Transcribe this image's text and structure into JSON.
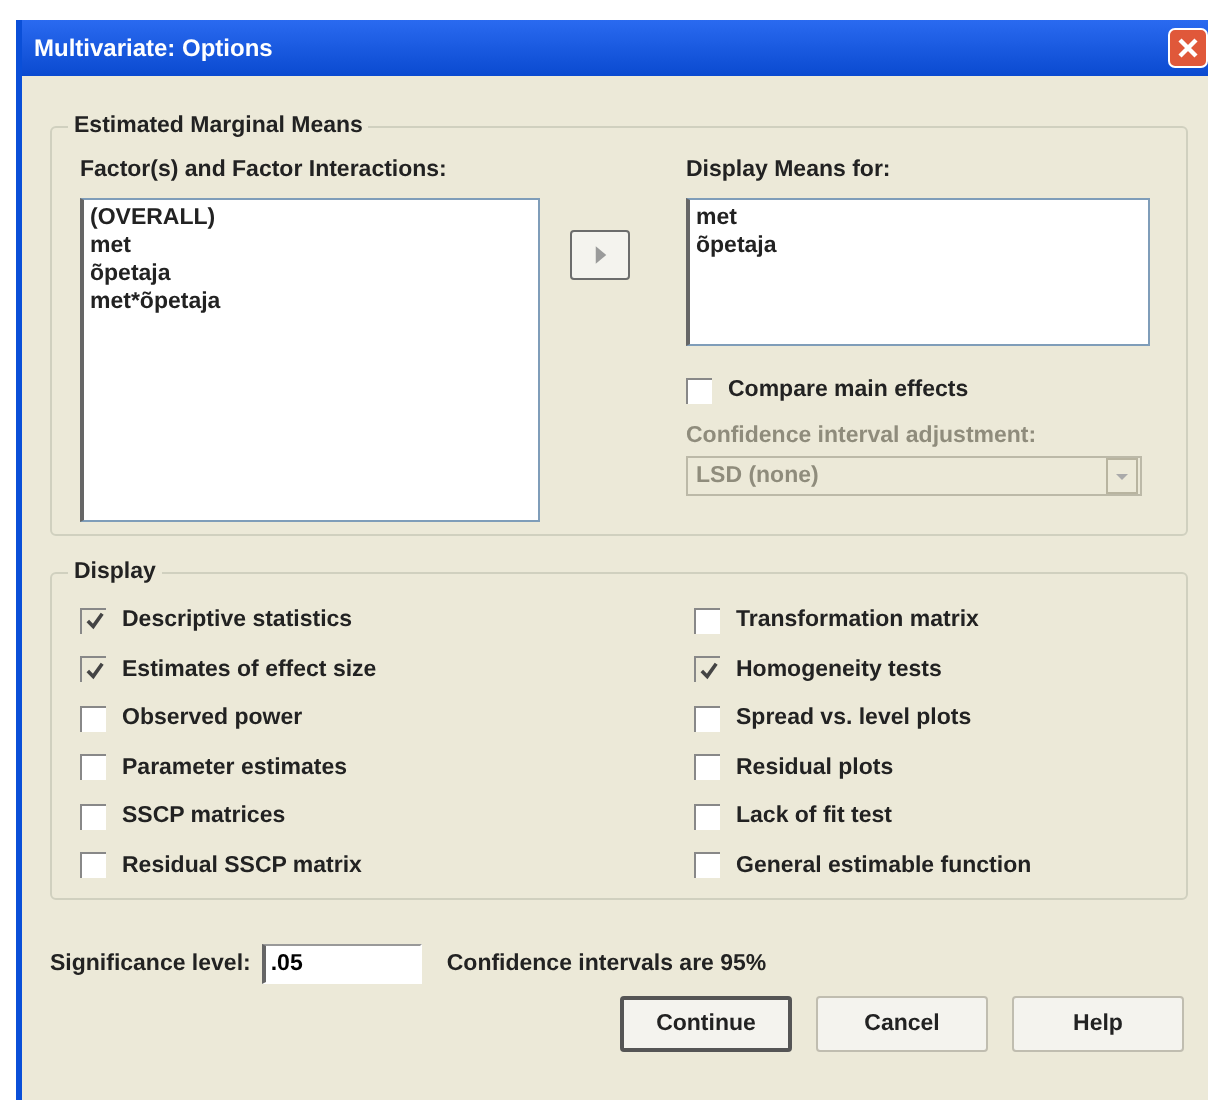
{
  "window": {
    "title": "Multivariate: Options"
  },
  "estimated_marginal_means": {
    "legend": "Estimated Marginal Means",
    "factors": {
      "label": "Factor(s) and Factor Interactions:",
      "items": [
        "(OVERALL)",
        "met",
        "õpetaja",
        "met*õpetaja"
      ]
    },
    "display_means": {
      "label": "Display Means for:",
      "items": [
        "met",
        "õpetaja"
      ]
    },
    "compare_main_effects": {
      "label": "Compare main effects",
      "checked": false
    },
    "adjustment": {
      "label": "Confidence interval adjustment:",
      "value": "LSD (none)",
      "disabled": true
    }
  },
  "display": {
    "legend": "Display",
    "options": [
      {
        "label": "Descriptive statistics",
        "checked": true
      },
      {
        "label": "Estimates of effect size",
        "checked": true
      },
      {
        "label": "Observed power",
        "checked": false
      },
      {
        "label": "Parameter estimates",
        "checked": false
      },
      {
        "label": "SSCP matrices",
        "checked": false
      },
      {
        "label": "Residual SSCP matrix",
        "checked": false
      },
      {
        "label": "Transformation matrix",
        "checked": false
      },
      {
        "label": "Homogeneity tests",
        "checked": true
      },
      {
        "label": "Spread vs. level plots",
        "checked": false
      },
      {
        "label": "Residual plots",
        "checked": false
      },
      {
        "label": "Lack of fit test",
        "checked": false
      },
      {
        "label": "General estimable function",
        "checked": false
      }
    ]
  },
  "significance": {
    "label": "Significance level:",
    "value": ".05",
    "note": "Confidence intervals are 95%"
  },
  "buttons": [
    {
      "label": "Continue",
      "default": true
    },
    {
      "label": "Cancel",
      "default": false
    },
    {
      "label": "Help",
      "default": false
    }
  ]
}
